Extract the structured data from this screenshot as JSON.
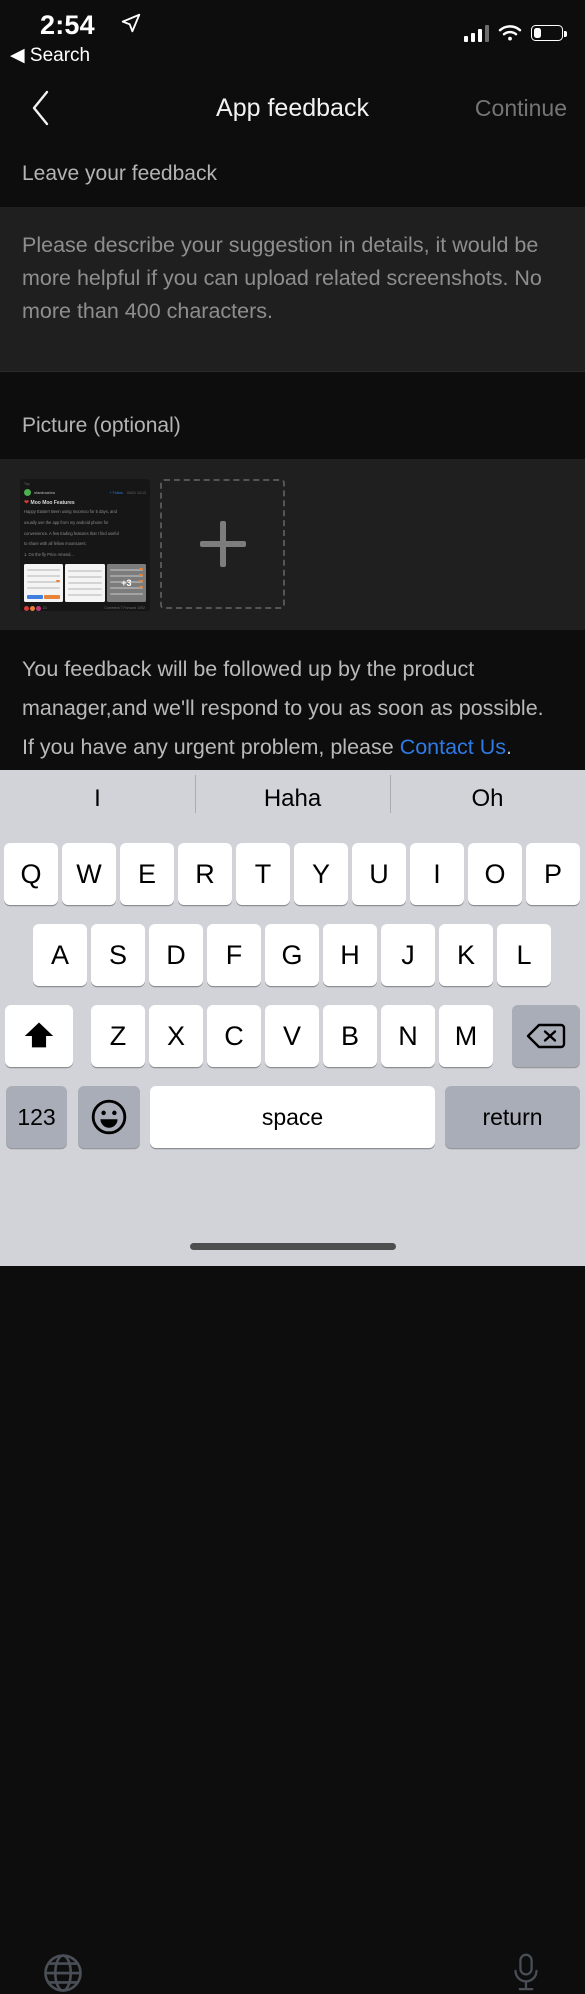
{
  "status_bar": {
    "time": "2:54",
    "back_label": "Search",
    "location_icon": "location-arrow-icon",
    "signal_icon": "cellular-signal-icon",
    "wifi_icon": "wifi-icon",
    "battery_icon": "battery-low-icon",
    "battery_level_pct": 25
  },
  "nav": {
    "back_icon": "chevron-left-icon",
    "title": "App feedback",
    "action_label": "Continue",
    "action_enabled": false
  },
  "feedback_section": {
    "header": "Leave your feedback",
    "placeholder": "Please describe your suggestion in details, it would be more helpful if you can upload related screenshots. No more than 400 characters.",
    "value": "",
    "max_characters": 400
  },
  "picture_section": {
    "header": "Picture (optional)",
    "add_icon": "plus-icon",
    "thumbnail": {
      "top_label": "Top",
      "username": "vlanhooleo",
      "follow_label": "+ Follow",
      "date": "04/21 13:13",
      "heart_emoji": "❤",
      "title": "Moo Moo Features",
      "body_lines": [
        "Happy Easter! Been using moomoo for 5 days, and",
        "usually use the app from my android phone for",
        "convenience. A few trading features that I find useful",
        "to share with all fellow moonsaers:",
        "1. On the fly Price Amend..."
      ],
      "more_images_badge": "+3",
      "reaction_count": "21",
      "meta": "Comment 7  Forward 1092"
    }
  },
  "note": {
    "text_before": "You feedback will be followed up by the product manager,and we'll respond to you as soon as possible. If you have any urgent problem, please ",
    "link_label": "Contact Us",
    "text_after": "."
  },
  "keyboard": {
    "predictions": [
      "I",
      "Haha",
      "Oh"
    ],
    "row1": [
      "Q",
      "W",
      "E",
      "R",
      "T",
      "Y",
      "U",
      "I",
      "O",
      "P"
    ],
    "row2": [
      "A",
      "S",
      "D",
      "F",
      "G",
      "H",
      "J",
      "K",
      "L"
    ],
    "row3": [
      "Z",
      "X",
      "C",
      "V",
      "B",
      "N",
      "M"
    ],
    "shift_icon": "shift-arrow-icon",
    "delete_icon": "backspace-icon",
    "numeric_label": "123",
    "emoji_icon": "smiley-face-icon",
    "space_label": "space",
    "return_label": "return",
    "globe_icon": "globe-icon",
    "mic_icon": "microphone-icon"
  },
  "colors": {
    "background": "#0d0d0d",
    "panel": "#1f1f1f",
    "link": "#2f7ae5",
    "keyboard_bg": "#d1d3d9",
    "key_white": "#ffffff",
    "key_gray": "#a9adb7"
  }
}
